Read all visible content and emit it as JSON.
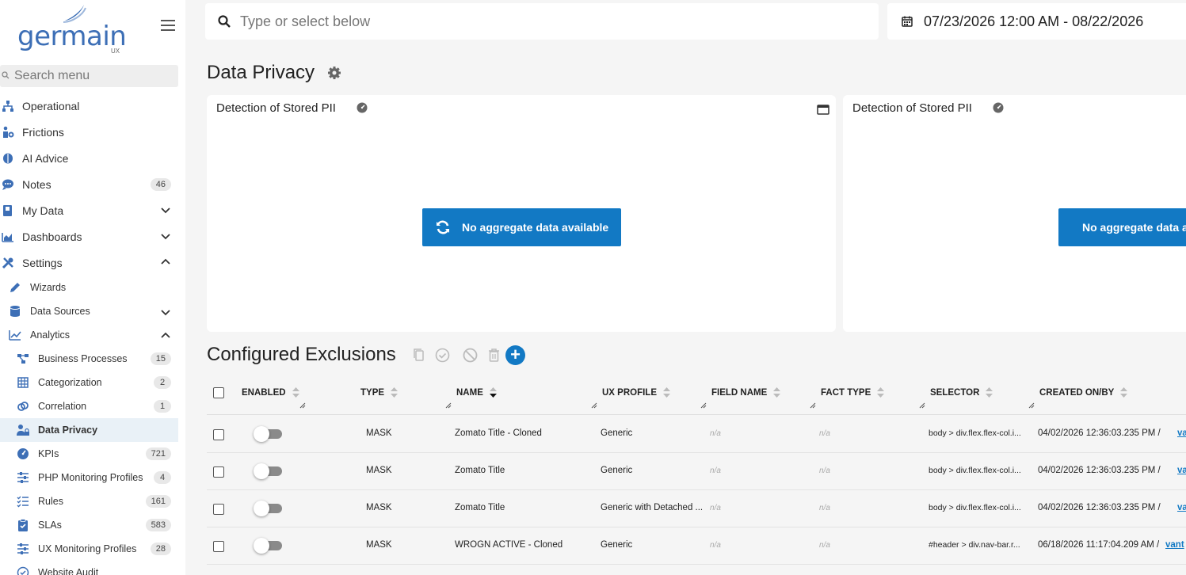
{
  "brand": {
    "name": "germain",
    "sub": "UX"
  },
  "sidebar": {
    "search_placeholder": "Search menu",
    "items": [
      {
        "label": "Operational",
        "icon": "sitemap-icon"
      },
      {
        "label": "Frictions",
        "icon": "person-friction-icon"
      },
      {
        "label": "AI Advice",
        "icon": "brain-icon"
      },
      {
        "label": "Notes",
        "icon": "comment-icon",
        "badge": "46"
      },
      {
        "label": "My Data",
        "icon": "book-icon"
      },
      {
        "label": "Dashboards",
        "icon": "chart-area-icon"
      },
      {
        "label": "Settings",
        "icon": "tools-icon"
      },
      {
        "label": "Wizards",
        "icon": "pencil-icon"
      },
      {
        "label": "Data Sources",
        "icon": "database-icon"
      },
      {
        "label": "Analytics",
        "icon": "line-chart-icon"
      },
      {
        "label": "Business Processes",
        "icon": "process-icon",
        "badge": "15"
      },
      {
        "label": "Categorization",
        "icon": "grid-icon",
        "badge": "2"
      },
      {
        "label": "Correlation",
        "icon": "link-icon",
        "badge": "1"
      },
      {
        "label": "Data Privacy",
        "icon": "user-lock-icon"
      },
      {
        "label": "KPIs",
        "icon": "gauge-icon",
        "badge": "721"
      },
      {
        "label": "PHP Monitoring Profiles",
        "icon": "sliders-icon",
        "badge": "4"
      },
      {
        "label": "Rules",
        "icon": "list-check-icon",
        "badge": "161"
      },
      {
        "label": "SLAs",
        "icon": "clipboard-check-icon",
        "badge": "583"
      },
      {
        "label": "UX Monitoring Profiles",
        "icon": "sliders-icon",
        "badge": "28"
      },
      {
        "label": "Website Audit",
        "icon": "check-circle-icon"
      }
    ]
  },
  "topbar": {
    "search_placeholder": "Type or select below",
    "date_range": "07/23/2026 12:00 AM - 08/22/2026"
  },
  "page": {
    "title": "Data Privacy"
  },
  "cards": [
    {
      "title": "Detection of Stored PII",
      "button": "No aggregate data available"
    },
    {
      "title": "Detection of Stored PII",
      "button": "No aggregate data available"
    }
  ],
  "exclusions": {
    "title": "Configured Exclusions",
    "columns": [
      "ENABLED",
      "TYPE",
      "NAME",
      "UX PROFILE",
      "FIELD NAME",
      "FACT TYPE",
      "SELECTOR",
      "CREATED ON/BY"
    ],
    "rows": [
      {
        "type": "MASK",
        "name": "Zomato Title - Cloned",
        "profile": "Generic",
        "field": "n/a",
        "fact": "n/a",
        "selector": "body > div.flex.flex-col.i...",
        "created": "04/02/2026 12:36:03.235 PM /",
        "by": "va"
      },
      {
        "type": "MASK",
        "name": "Zomato Title",
        "profile": "Generic",
        "field": "n/a",
        "fact": "n/a",
        "selector": "body > div.flex.flex-col.i...",
        "created": "04/02/2026 12:36:03.235 PM /",
        "by": "va"
      },
      {
        "type": "MASK",
        "name": "Zomato Title",
        "profile": "Generic with Detached ...",
        "field": "n/a",
        "fact": "n/a",
        "selector": "body > div.flex.flex-col.i...",
        "created": "04/02/2026 12:36:03.235 PM /",
        "by": "va"
      },
      {
        "type": "MASK",
        "name": "WROGN ACTIVE - Cloned",
        "profile": "Generic",
        "field": "n/a",
        "fact": "n/a",
        "selector": "#header > div.nav-bar.r...",
        "created": "06/18/2026 11:17:04.209 AM /",
        "by": "vant"
      }
    ]
  },
  "colors": {
    "brand": "#3d6fb6",
    "accent": "#1279c4",
    "active_bg": "#e9f1f7"
  }
}
